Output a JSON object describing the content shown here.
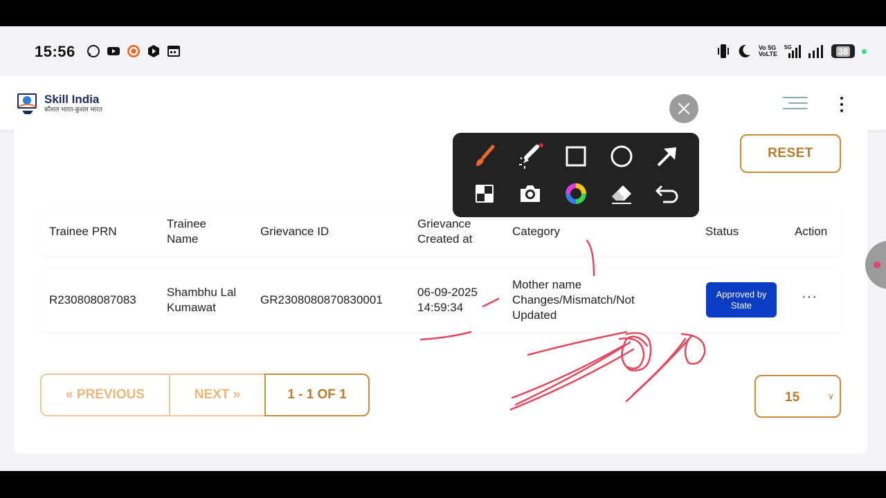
{
  "status_bar": {
    "time": "15:56",
    "app_icons": [
      "whatsapp-icon",
      "youtube-icon",
      "c-app-icon",
      "play-store-icon",
      "calendar-icon"
    ],
    "network_label_1": "Vo 5G",
    "network_label_2": "VoLTE",
    "network_5g": "5G",
    "battery": "38"
  },
  "header": {
    "logo_title": "Skill India",
    "logo_subtitle": "कौशल भारत-कुशल भारत"
  },
  "filters": {
    "reset_label": "RESET"
  },
  "table": {
    "columns": [
      "Trainee PRN",
      "Trainee Name",
      "Grievance ID",
      "Grievance Created at",
      "Category",
      "Status",
      "Action"
    ],
    "rows": [
      {
        "prn": "R230808087083",
        "name": "Shambhu Lal Kumawat",
        "grievance_id": "GR2308080870830001",
        "created_at": "06-09-2025 14:59:34",
        "category": "Mother name Changes/Mismatch/Not Updated",
        "status": "Approved by State",
        "action": "···"
      }
    ]
  },
  "pagination": {
    "prev_label": "« PREVIOUS",
    "next_label": "NEXT »",
    "info": "1 - 1 OF 1",
    "per_page": "15"
  },
  "annotation_toolbar": {
    "tools_row1": [
      "brush-icon",
      "magic-marker-icon",
      "rectangle-icon",
      "circle-icon",
      "arrow-icon"
    ],
    "tools_row2": [
      "mosaic-icon",
      "camera-icon",
      "color-wheel-icon",
      "eraser-icon",
      "undo-icon"
    ],
    "brush_color": "#e8692a",
    "annotation_color": "#e0485f"
  },
  "colors": {
    "accent": "#c98a3a",
    "status_badge": "#0a3cc2"
  }
}
